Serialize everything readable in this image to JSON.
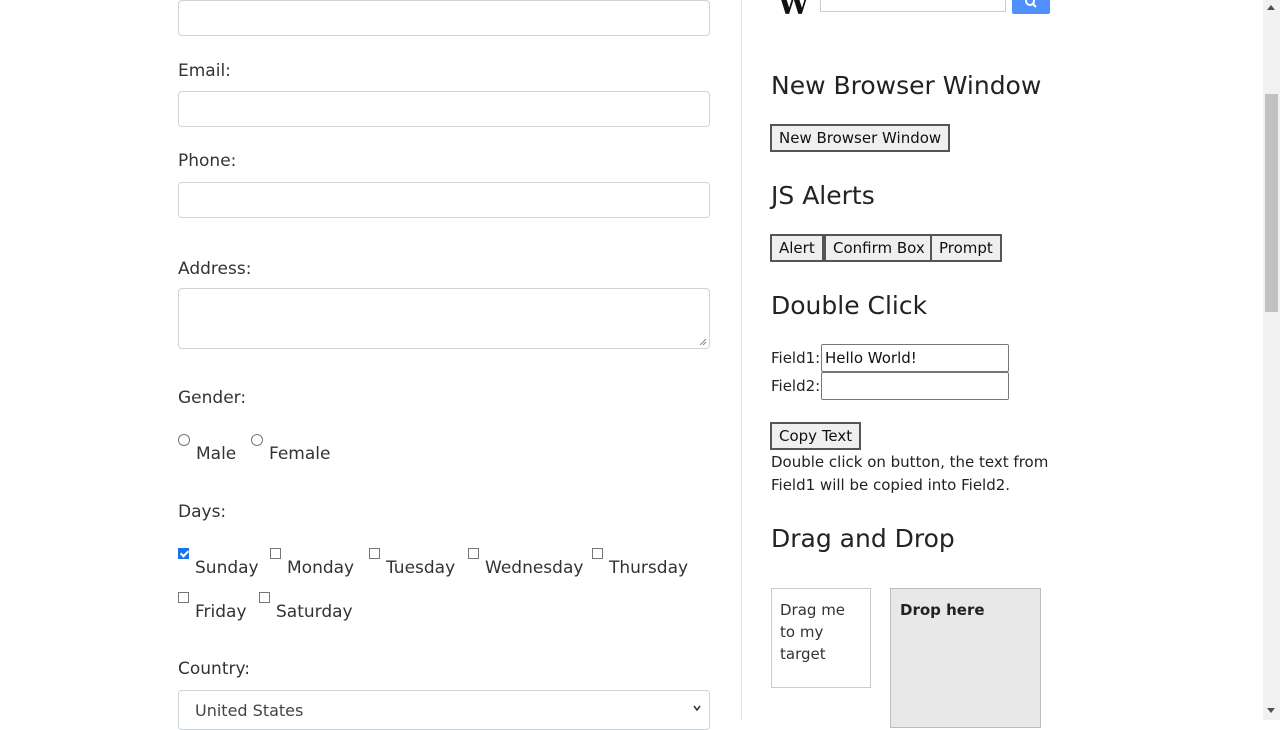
{
  "form": {
    "email_label": "Email:",
    "phone_label": "Phone:",
    "address_label": "Address:",
    "gender_label": "Gender:",
    "gender_options": [
      "Male",
      "Female"
    ],
    "days_label": "Days:",
    "days": [
      {
        "label": "Sunday",
        "checked": true
      },
      {
        "label": "Monday",
        "checked": false
      },
      {
        "label": "Tuesday",
        "checked": false
      },
      {
        "label": "Wednesday",
        "checked": false
      },
      {
        "label": "Thursday",
        "checked": false
      },
      {
        "label": "Friday",
        "checked": false
      },
      {
        "label": "Saturday",
        "checked": false
      }
    ],
    "country_label": "Country:",
    "country_selected": "United States"
  },
  "header": {
    "logo_text": "W",
    "search_icon": "search-icon",
    "accent_color": "#4d90fe"
  },
  "new_window": {
    "title": "New Browser Window",
    "button": "New Browser Window"
  },
  "alerts": {
    "title": "JS Alerts",
    "alert_button": "Alert",
    "confirm_button": "Confirm Box",
    "prompt_button": "Prompt"
  },
  "double_click": {
    "title": "Double Click",
    "field1_label": "Field1:",
    "field1_value": "Hello World!",
    "field2_label": "Field2:",
    "field2_value": "",
    "copy_button": "Copy Text",
    "description": "Double click on button, the text from Field1 will be copied into Field2."
  },
  "drag_drop": {
    "title": "Drag and Drop",
    "draggable_text": "Drag me to my target",
    "droppable_text": "Drop here"
  }
}
